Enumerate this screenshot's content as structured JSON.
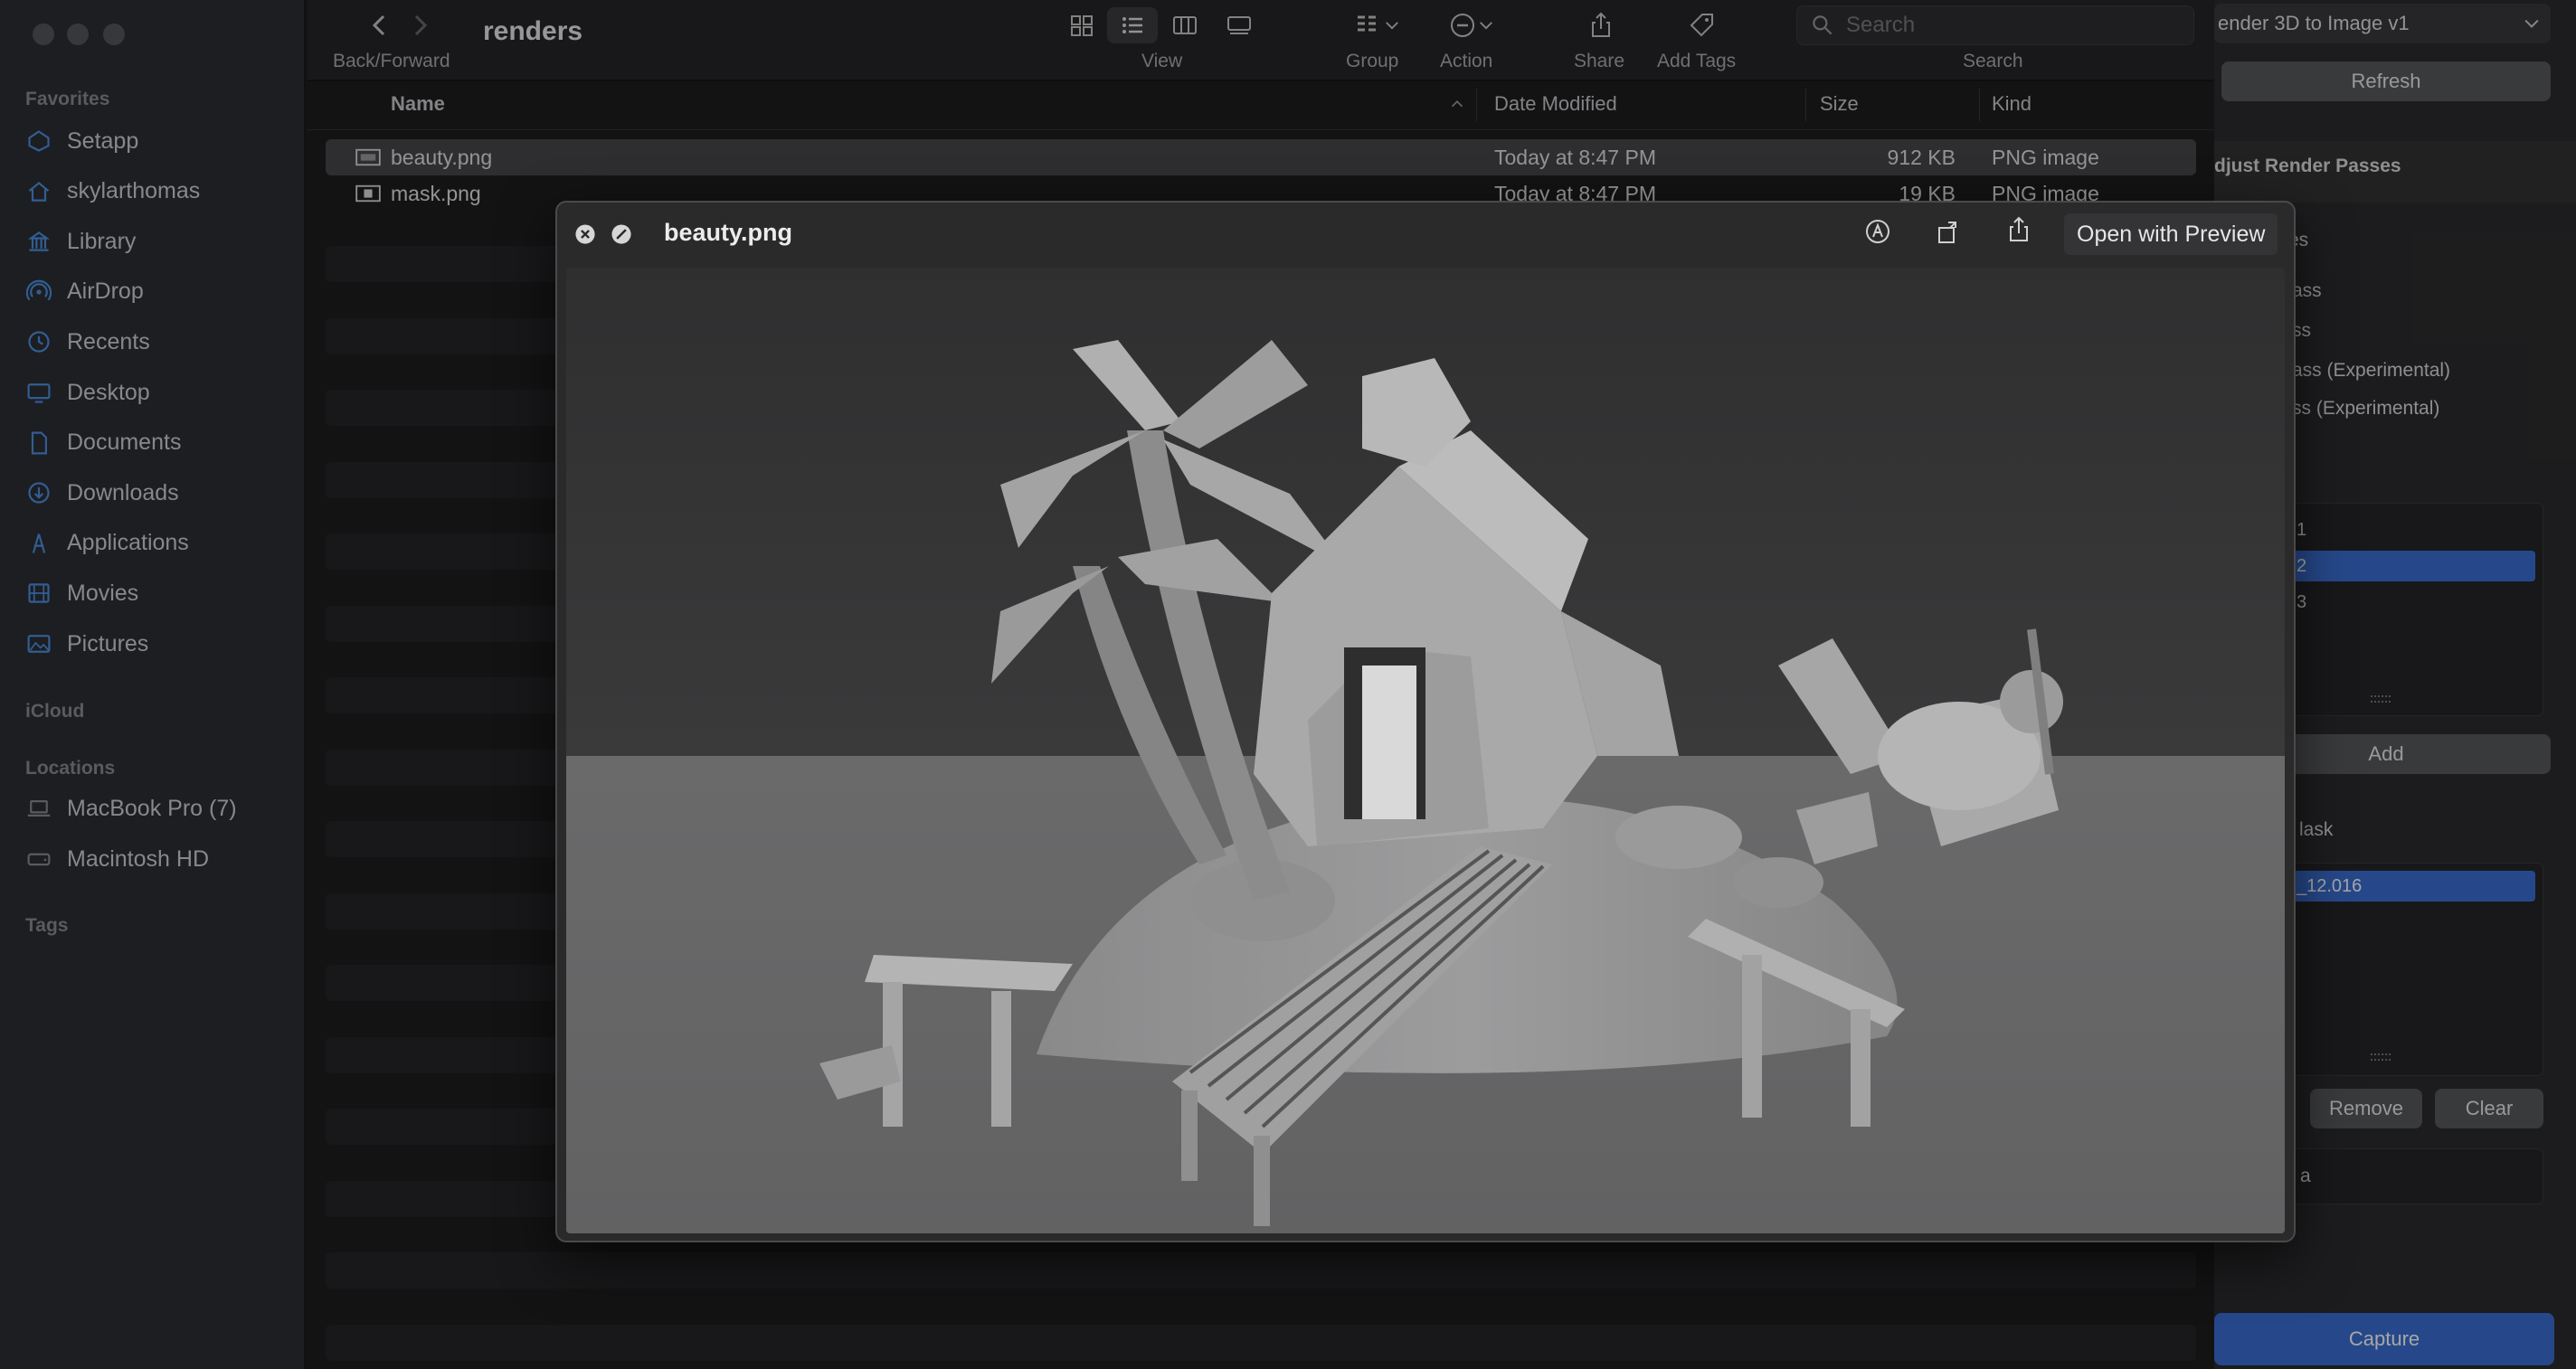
{
  "sidebar": {
    "sections": {
      "favorites": "Favorites",
      "icloud": "iCloud",
      "locations": "Locations",
      "tags": "Tags"
    },
    "favorites": [
      {
        "label": "Setapp",
        "icon": "setapp-icon"
      },
      {
        "label": "skylarthomas",
        "icon": "home-icon"
      },
      {
        "label": "Library",
        "icon": "library-icon"
      },
      {
        "label": "AirDrop",
        "icon": "airdrop-icon"
      },
      {
        "label": "Recents",
        "icon": "clock-icon"
      },
      {
        "label": "Desktop",
        "icon": "desktop-icon"
      },
      {
        "label": "Documents",
        "icon": "document-icon"
      },
      {
        "label": "Downloads",
        "icon": "download-icon"
      },
      {
        "label": "Applications",
        "icon": "applications-icon"
      },
      {
        "label": "Movies",
        "icon": "film-icon"
      },
      {
        "label": "Pictures",
        "icon": "photo-icon"
      }
    ],
    "locations": [
      {
        "label": "MacBook Pro (7)",
        "icon": "laptop-icon"
      },
      {
        "label": "Macintosh HD",
        "icon": "disk-icon"
      }
    ]
  },
  "toolbar": {
    "title": "renders",
    "back_forward_label": "Back/Forward",
    "view_label": "View",
    "group_label": "Group",
    "action_label": "Action",
    "share_label": "Share",
    "add_tags_label": "Add Tags",
    "search_label": "Search",
    "search_placeholder": "Search"
  },
  "list": {
    "columns": {
      "name": "Name",
      "date": "Date Modified",
      "size": "Size",
      "kind": "Kind"
    },
    "files": [
      {
        "name": "beauty.png",
        "date": "Today at 8:47 PM",
        "size": "912 KB",
        "kind": "PNG image"
      },
      {
        "name": "mask.png",
        "date": "Today at 8:47 PM",
        "size": "19 KB",
        "kind": "PNG image"
      }
    ]
  },
  "right_panel": {
    "dropdown": "ender 3D to Image v1",
    "refresh": "Refresh",
    "adjust_heading": "djust Render Passes",
    "pass_lines": [
      "es",
      "ass",
      "ss",
      "ass (Experimental)",
      "ss (Experimental)"
    ],
    "list1": [
      "1",
      "2",
      "3"
    ],
    "list1_selected": "2",
    "add": "Add",
    "mask_label": "lask",
    "list2_selected": "_12.016",
    "remove": "Remove",
    "clear": "Clear",
    "field_text": "a",
    "capture": "Capture",
    "accent": "#3b6fd4"
  },
  "quicklook": {
    "title": "beauty.png",
    "open_with": "Open with Preview"
  }
}
